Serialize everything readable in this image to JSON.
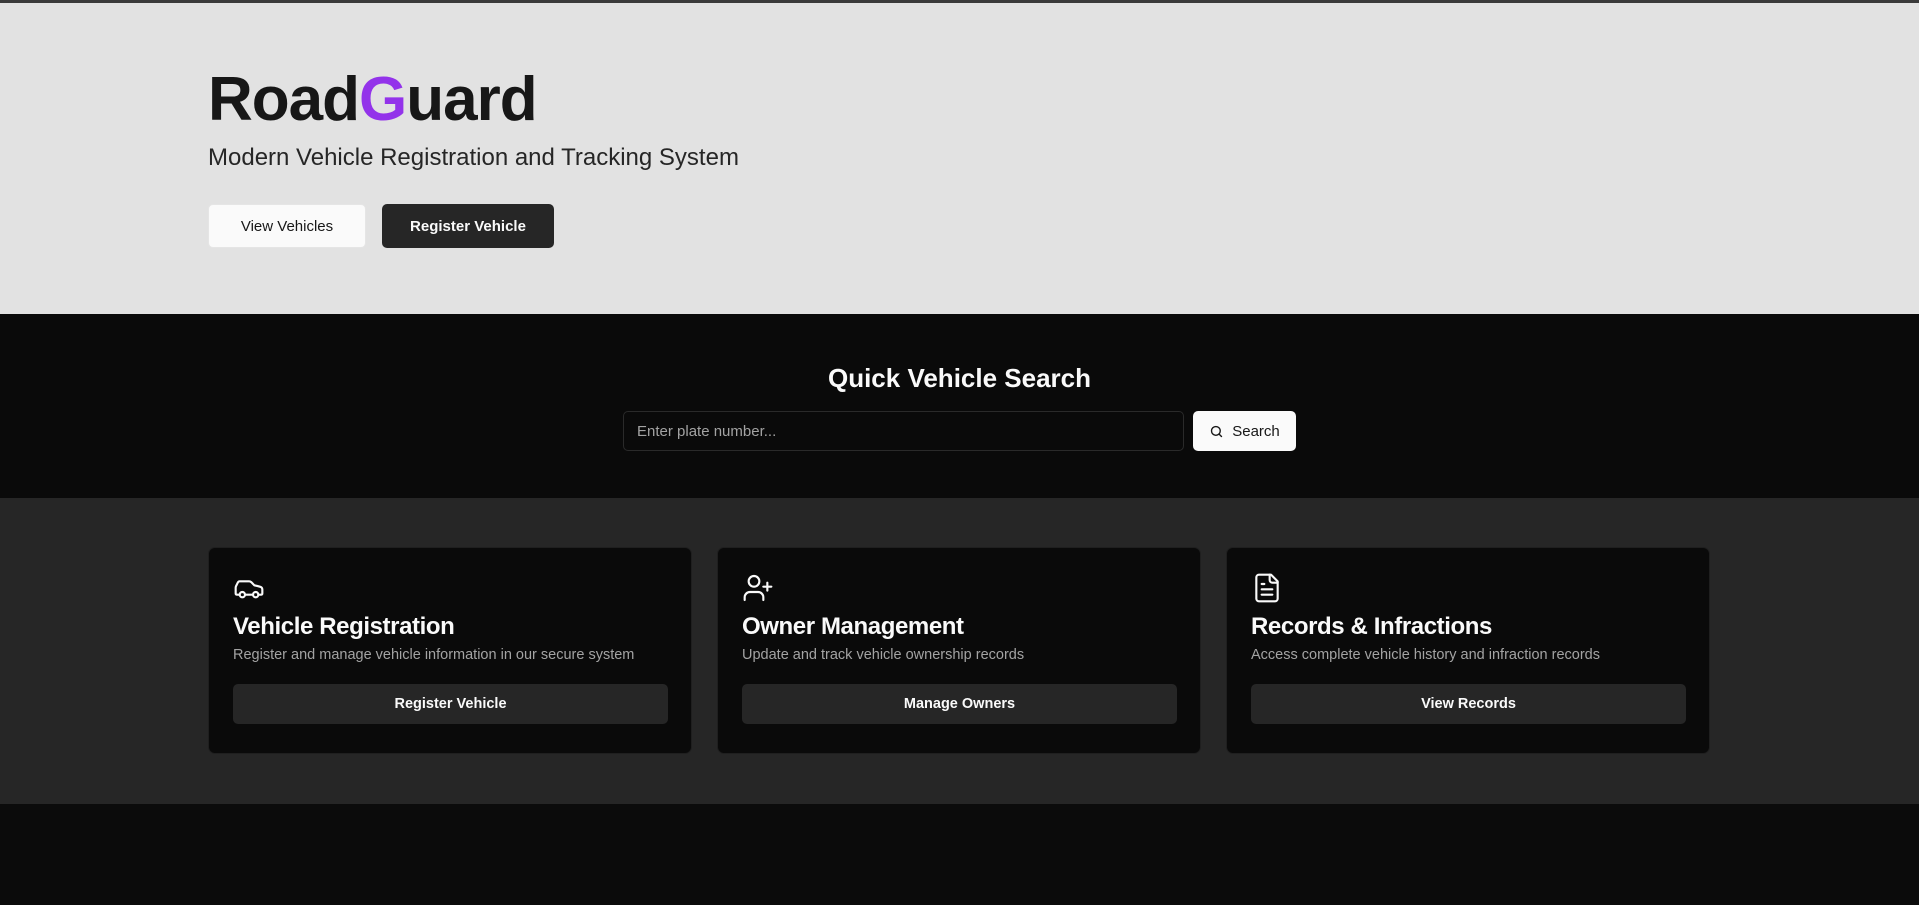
{
  "hero": {
    "brand_start": "Road",
    "brand_accent": "G",
    "brand_end": "uard",
    "tagline": "Modern Vehicle Registration and Tracking System",
    "view_vehicles_label": "View Vehicles",
    "register_vehicle_label": "Register Vehicle",
    "accent_color": "#9333ea"
  },
  "search": {
    "title": "Quick Vehicle Search",
    "placeholder": "Enter plate number...",
    "value": "",
    "button_label": "Search",
    "button_icon": "search-icon"
  },
  "features": [
    {
      "icon": "car-icon",
      "title": "Vehicle Registration",
      "description": "Register and manage vehicle information in our secure system",
      "button_label": "Register Vehicle"
    },
    {
      "icon": "user-plus-icon",
      "title": "Owner Management",
      "description": "Update and track vehicle ownership records",
      "button_label": "Manage Owners"
    },
    {
      "icon": "file-text-icon",
      "title": "Records & Infractions",
      "description": "Access complete vehicle history and infraction records",
      "button_label": "View Records"
    }
  ]
}
